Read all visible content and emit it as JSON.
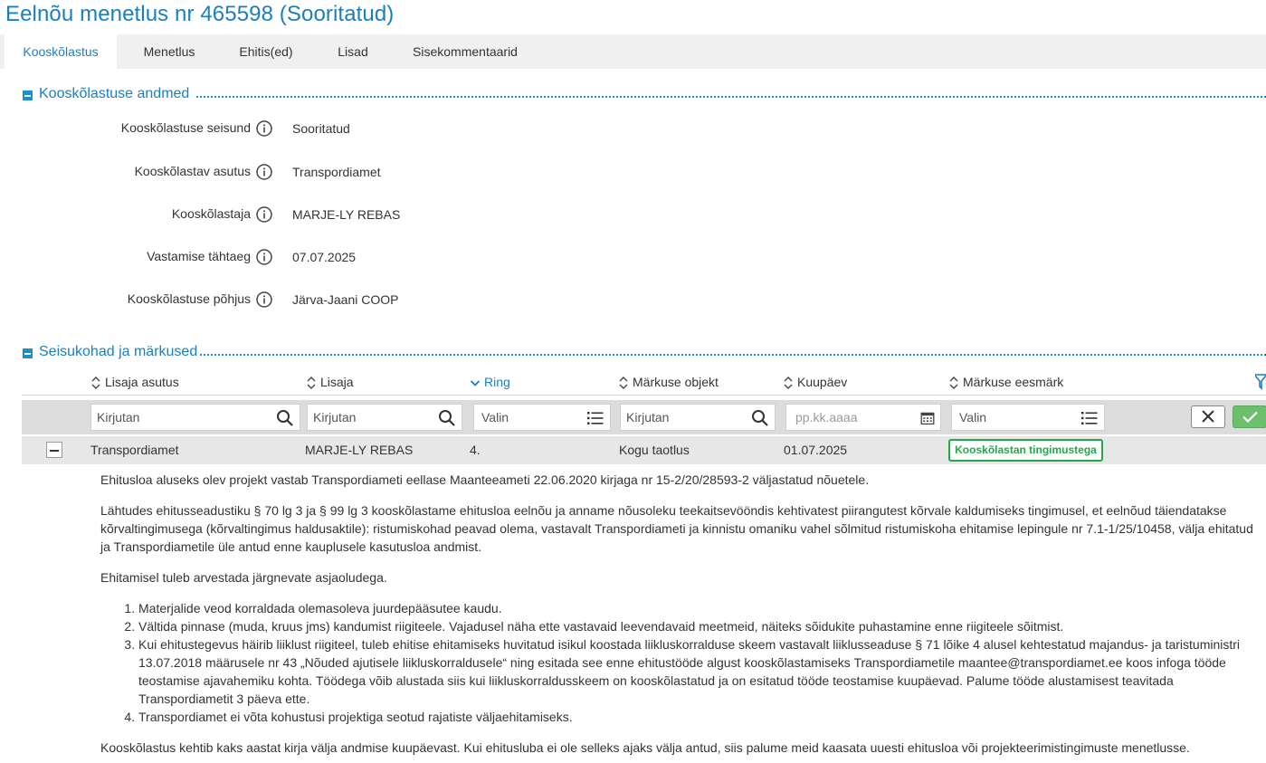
{
  "page": {
    "title": "Eelnõu menetlus nr 465598 (Sooritatud)"
  },
  "tabs": [
    {
      "label": "Kooskõlastus",
      "active": true
    },
    {
      "label": "Menetlus"
    },
    {
      "label": "Ehitis(ed)"
    },
    {
      "label": "Lisad"
    },
    {
      "label": "Sisekommentaarid"
    }
  ],
  "section1": {
    "title": "Kooskõlastuse andmed",
    "fields": [
      {
        "label": "Kooskõlastuse seisund",
        "value": "Sooritatud"
      },
      {
        "label": "Kooskõlastav asutus",
        "value": "Transpordiamet"
      },
      {
        "label": "Kooskõlastaja",
        "value": "MARJE-LY REBAS"
      },
      {
        "label": "Vastamise tähtaeg",
        "value": "07.07.2025"
      },
      {
        "label": "Kooskõlastuse põhjus",
        "value": "Järva-Jaani COOP"
      }
    ]
  },
  "section2": {
    "title": "Seisukohad ja märkused",
    "columns": [
      "Lisaja asutus",
      "Lisaja",
      "Ring",
      "Märkuse objekt",
      "Kuupäev",
      "Märkuse eesmärk"
    ],
    "filters": {
      "lisaja_asutus": "Kirjutan",
      "lisaja": "Kirjutan",
      "ring": "Valin",
      "objekt": "Kirjutan",
      "kuupaev": "pp.kk.aaaa",
      "eesmark": "Valin"
    },
    "row": {
      "asutus": "Transpordiamet",
      "lisaja": "MARJE-LY REBAS",
      "ring": "4.",
      "objekt": "Kogu taotlus",
      "kuupaev": "01.07.2025",
      "eesmark": "Kooskõlastan tingimustega"
    },
    "comment": {
      "p1": "Ehitusloa aluseks olev projekt vastab Transpordiameti eellase Maanteeameti 22.06.2020 kirjaga nr 15-2/20/28593-2 väljastatud nõuetele.",
      "p2": "Lähtudes ehitusseadustiku § 70 lg 3 ja § 99 lg 3 kooskõlastame ehitusloa eelnõu ja anname nõusoleku teekaitsevööndis kehtivatest piirangutest kõrvale kaldumiseks tingimusel, et eelnõud täiendatakse kõrvaltingimusega (kõrvaltingimus haldusaktile): ristumiskohad peavad olema, vastavalt Transpordiameti ja kinnistu omaniku vahel sõlmitud ristumiskoha ehitamise lepingule nr 7.1-1/25/10458, välja ehitatud ja Transpordiametile üle antud enne kauplusele kasutusloa andmist.",
      "p3": "Ehitamisel tuleb arvestada järgnevate asjaoludega.",
      "items": [
        "Materjalide veod korraldada olemasoleva juurdepääsutee kaudu.",
        "Vältida pinnase (muda, kruus jms) kandumist riigiteele. Vajadusel näha ette vastavaid leevendavaid meetmeid, näiteks sõidukite puhastamine enne riigiteele sõitmist.",
        "Kui ehitustegevus häirib liiklust riigiteel, tuleb ehitise ehitamiseks huvitatud isikul koostada liikluskorralduse skeem vastavalt liiklusseaduse § 71 lõike 4 alusel kehtestatud majandus- ja taristuministri 13.07.2018 määrusele nr 43 „Nõuded ajutisele liikluskorraldusele“ ning esitada see enne ehitustööde algust kooskõlastamiseks Transpordiametile maantee@transpordiamet.ee koos infoga tööde teostamise ajavahemiku kohta. Töödega võib alustada siis kui liikluskorraldusskeem on kooskõlastatud ja on esitatud tööde teostamise kuupäevad. Palume tööde alustamisest teavitada Transpordiametit 3 päeva ette.",
        "Transpordiamet ei võta kohustusi projektiga seotud rajatiste väljaehitamiseks."
      ],
      "p4": "Kooskõlastus kehtib kaks aastat kirja välja andmise kuupäevast. Kui ehitusluba ei ole selleks ajaks välja antud, siis palume meid kaasata uuesti ehitusloa või projekteerimistingimuste menetlusse."
    }
  },
  "colors": {
    "accent": "#1a7fbf",
    "badge": "#22a84a",
    "ok": "#6cc06c"
  },
  "icons": [
    "info-icon",
    "sort-icon",
    "search-icon",
    "list-icon",
    "calendar-icon",
    "filter-icon",
    "close-icon",
    "check-icon",
    "minus-icon"
  ]
}
